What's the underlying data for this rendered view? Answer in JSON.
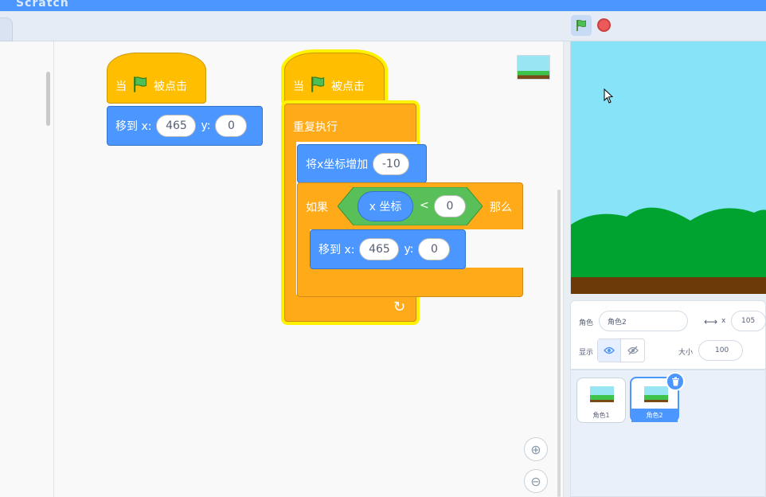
{
  "toolbar": {
    "logo_text": "Scratch"
  },
  "left_script": {
    "hat_when": "当",
    "hat_clicked": "被点击",
    "goto_prefix": "移到 x:",
    "goto_x": "465",
    "goto_y_label": "y:",
    "goto_y": "0"
  },
  "right_script": {
    "hat_when": "当",
    "hat_clicked": "被点击",
    "forever": "重复执行",
    "change_x_label": "将x坐标增加",
    "change_x_value": "-10",
    "if_label": "如果",
    "if_then": "那么",
    "x_position": "x 坐标",
    "lt_symbol": "<",
    "compare_value": "0",
    "goto_prefix": "移到 x:",
    "goto_x": "465",
    "goto_y_label": "y:",
    "goto_y": "0",
    "loop_arrow": "↻"
  },
  "sprite_info": {
    "sprite_label": "角色",
    "sprite_name": "角色2",
    "x_label": "x",
    "x_value": "105",
    "show_label": "显示",
    "size_label": "大小",
    "size_value": "100"
  },
  "sprites": [
    {
      "name": "角色1"
    },
    {
      "name": "角色2"
    }
  ],
  "colors": {
    "event": "#ffbf00",
    "motion": "#4c97ff",
    "control": "#ffab19",
    "operators": "#59c059",
    "sky": "#87e4f8",
    "grass": "#00a32f",
    "ground": "#6b3a08"
  }
}
